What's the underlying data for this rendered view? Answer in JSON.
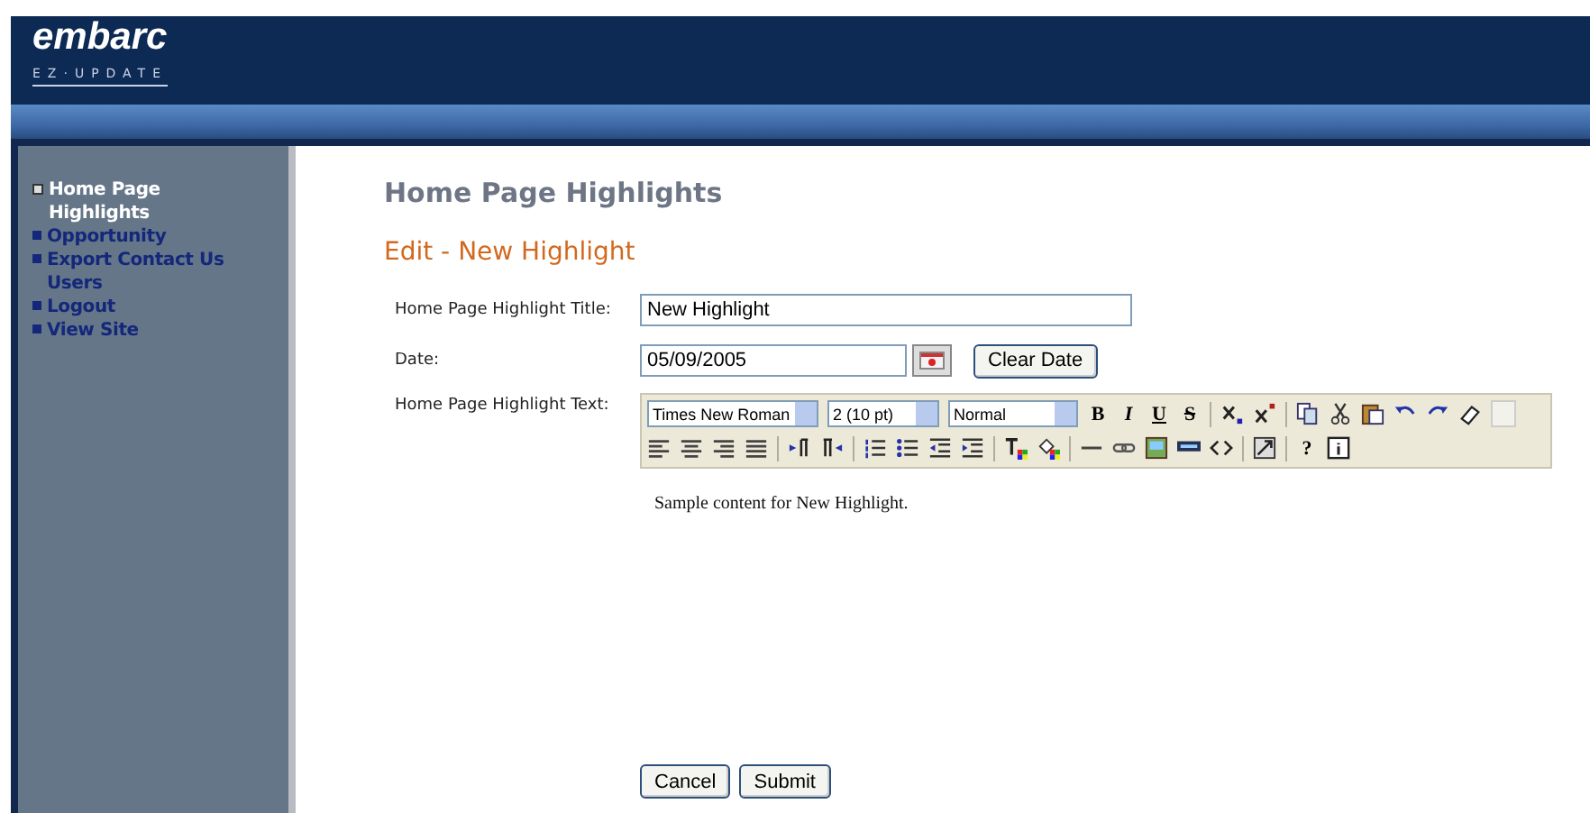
{
  "header": {
    "logo": "embarc",
    "tagline": "EZ·UPDATE"
  },
  "sidebar": {
    "items": [
      {
        "label": "Home Page Highlights",
        "selected": true
      },
      {
        "label": "Opportunity",
        "selected": false
      },
      {
        "label": "Export Contact Us Users",
        "selected": false
      },
      {
        "label": "Logout",
        "selected": false
      },
      {
        "label": "View Site",
        "selected": false
      }
    ]
  },
  "page_title": "Home Page Highlights",
  "subtitle": "Edit - New Highlight",
  "form": {
    "title_label": "Home Page Highlight Title:",
    "title_value": "New Highlight",
    "date_label": "Date:",
    "date_value": "05/09/2005",
    "clear_date": "Clear Date",
    "text_label": "Home Page Highlight Text:",
    "editor": {
      "font": "Times New Roman",
      "size": "2 (10 pt)",
      "format": "Normal",
      "bold": "B",
      "italic": "I",
      "underline": "U",
      "strike": "S",
      "help": "?"
    },
    "content": "Sample content for New Highlight."
  },
  "buttons": [
    "Cancel",
    "Submit"
  ]
}
